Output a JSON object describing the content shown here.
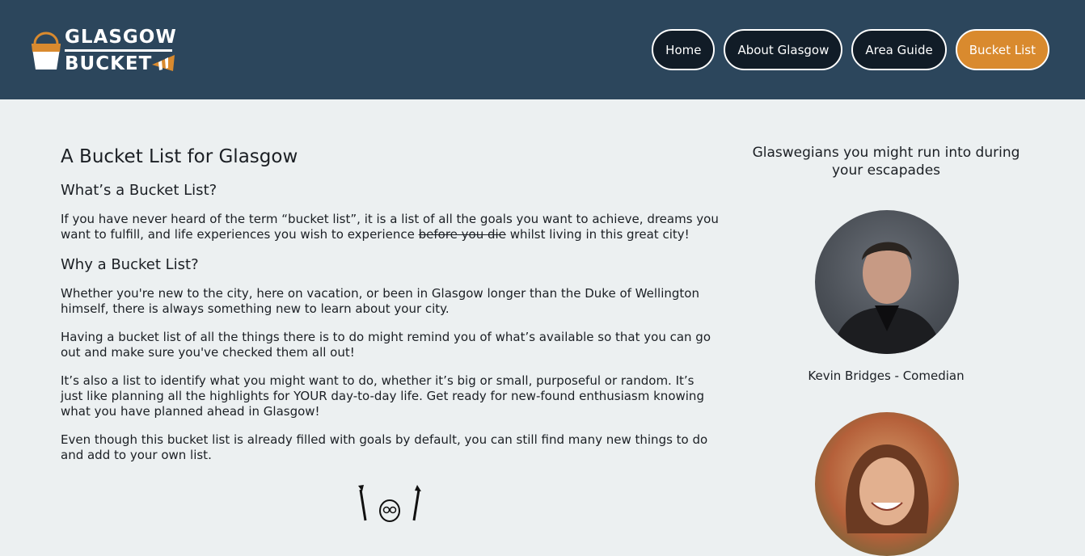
{
  "brand": {
    "line1": "GLASGOW",
    "line2": "BUCKET",
    "accent": "#d98a2e",
    "header_bg": "#2c465c"
  },
  "nav": {
    "items": [
      {
        "label": "Home"
      },
      {
        "label": "About Glasgow"
      },
      {
        "label": "Area Guide"
      },
      {
        "label": "Bucket List",
        "active": true
      }
    ]
  },
  "main": {
    "title": "A Bucket List for Glasgow",
    "section1": {
      "heading": "What’s a Bucket List?",
      "text_before": "If you have never heard of the term “bucket list”, it is a list of all the goals you want to achieve, dreams you want to fulfill, and life experiences you wish to experience ",
      "text_struck": "before you die",
      "text_after": " whilst living in this great city!"
    },
    "section2": {
      "heading": "Why a Bucket List?",
      "p1": "Whether you're new to the city, here on vacation, or been in Glasgow longer than the Duke of Wellington himself, there is always something new to learn about your city.",
      "p2": "Having a bucket list of all the things there is to do might remind you of what’s available so that you can go out and make sure you've checked them all out!",
      "p3": "It’s also a list to identify what you might want to do, whether it’s big or small, purposeful or random. It’s just like planning all the highlights for YOUR day-to-day life. Get ready for new-found enthusiasm knowing what you have planned ahead in Glasgow!",
      "p4": "Even though this bucket list is already filled with goals by default, you can still find many new things to do and add to your own list."
    }
  },
  "aside": {
    "title": "Glaswegians you might run into during your escapades",
    "people": [
      {
        "caption": "Kevin Bridges - Comedian"
      },
      {
        "caption": ""
      }
    ]
  }
}
